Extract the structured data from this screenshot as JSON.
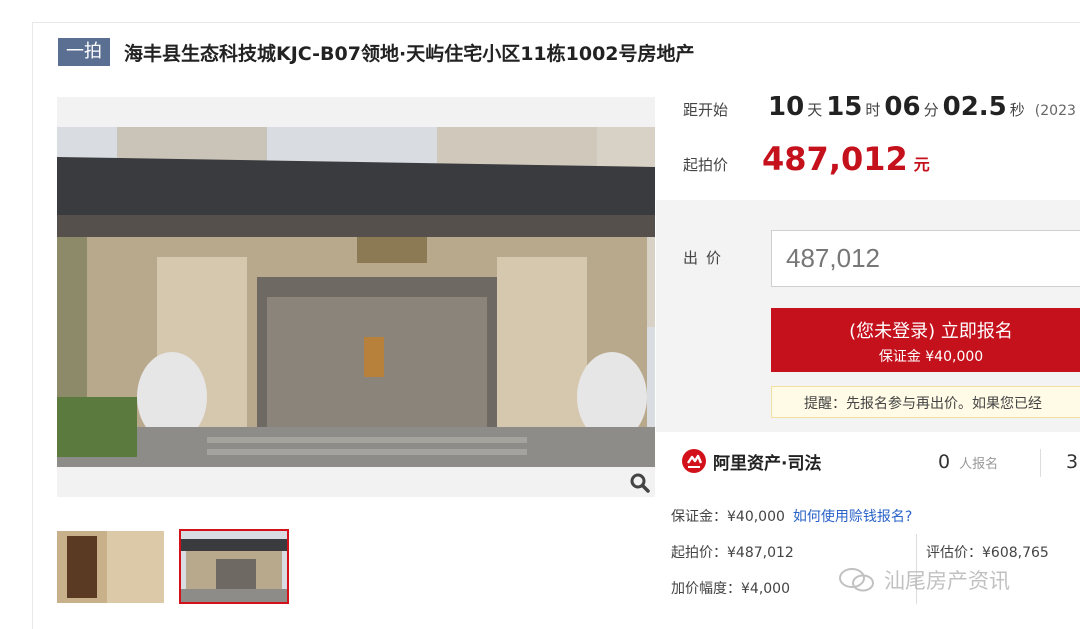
{
  "header": {
    "tag": "一拍",
    "title": "海丰县生态科技城KJC-B07领地·天屿住宅小区11栋1002号房地产"
  },
  "countdown": {
    "label": "距开始",
    "days": "10",
    "days_unit": "天",
    "hours": "15",
    "hours_unit": "时",
    "minutes": "06",
    "minutes_unit": "分",
    "seconds": "02.5",
    "seconds_unit": "秒",
    "date_note": "(2023"
  },
  "start_price": {
    "label": "起拍价",
    "value": "487,012",
    "unit": "元"
  },
  "bid": {
    "label": "出价",
    "input_value": "487,012",
    "signup_line1": "(您未登录) 立即报名",
    "signup_line2": "保证金 ¥40,000",
    "reminder": "提醒：先报名参与再出价。如果您已经"
  },
  "brand": {
    "name": "阿里资产·司法"
  },
  "stats": {
    "signup_count": "0",
    "signup_unit": "人报名",
    "second_value": "3"
  },
  "info": {
    "deposit": "保证金：¥40,000",
    "deposit_link": "如何使用赊钱报名?",
    "start_price": "起拍价：¥487,012",
    "appraisal": "评估价：¥608,765",
    "increment": "加价幅度：¥4,000"
  },
  "watermark": {
    "text": "汕尾房产资讯"
  },
  "colors": {
    "accent_red": "#c4111c",
    "tag_bg": "#5b6f93",
    "link_blue": "#2a63c8"
  }
}
